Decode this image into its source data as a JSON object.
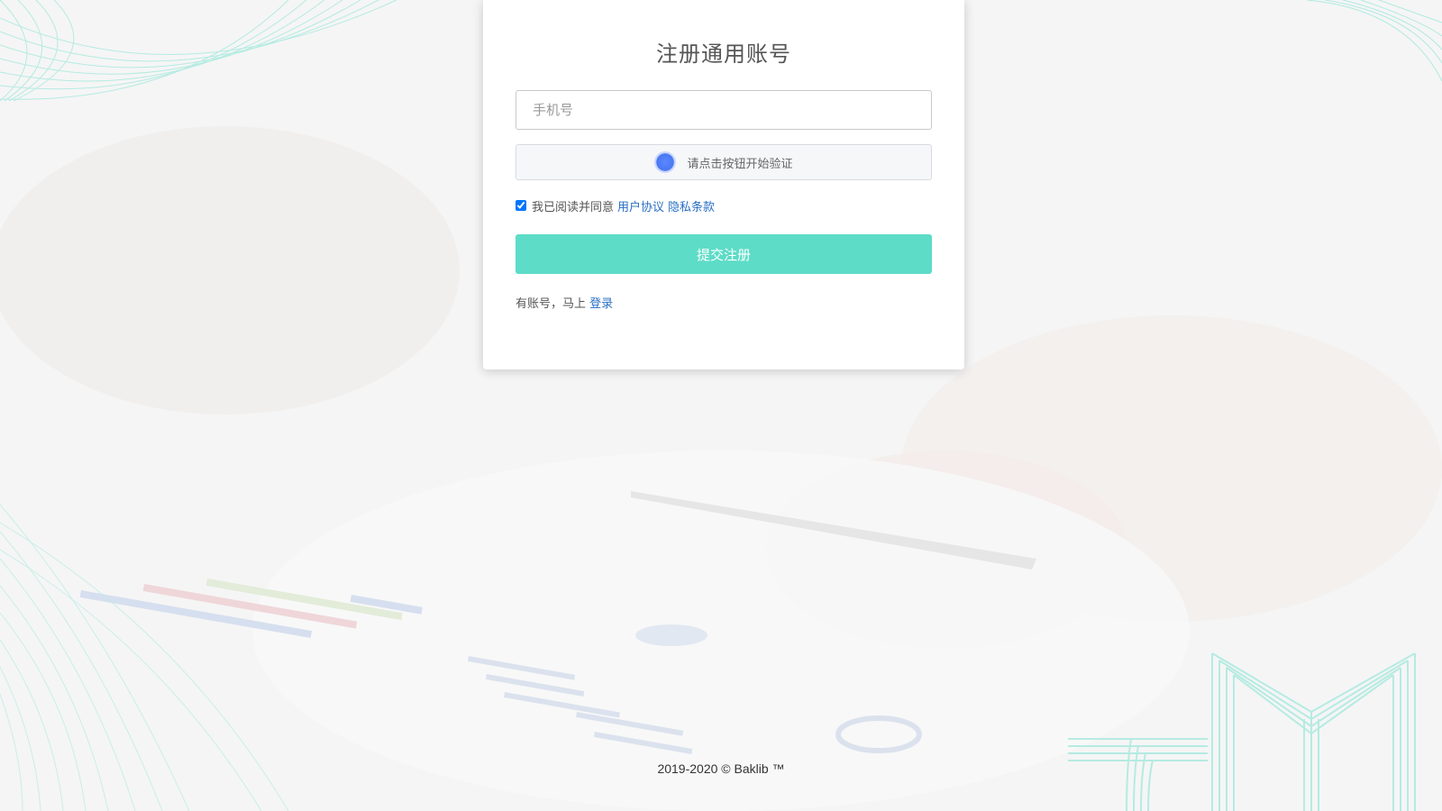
{
  "form": {
    "title": "注册通用账号",
    "phone_placeholder": "手机号",
    "verify_text": "请点击按钮开始验证",
    "agree_prefix": "我已阅读并同意",
    "user_agreement_link": "用户协议",
    "privacy_link": "隐私条款",
    "agree_checked": true,
    "submit_label": "提交注册",
    "login_prefix": "有账号，马上",
    "login_link": "登录"
  },
  "footer": {
    "copyright": "2019-2020 © Baklib ™"
  },
  "colors": {
    "accent": "#5ddcc7",
    "link": "#2a6fc4",
    "verify_dot": "#4a78f2"
  }
}
